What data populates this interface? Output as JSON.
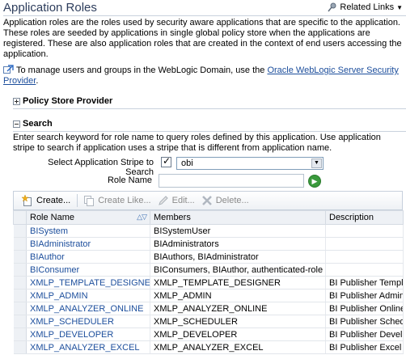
{
  "header": {
    "title": "Application Roles",
    "related_links": "Related Links"
  },
  "description": "Application roles are the roles used by security aware applications that are specific to the application. These roles are seeded by applications in single global policy store when the applications are registered. These are also application roles that are created in the context of end users accessing the application.",
  "info": {
    "text": "To manage users and groups in the WebLogic Domain, use the ",
    "link": "Oracle WebLogic Server Security Provider",
    "suffix": "."
  },
  "sections": {
    "policy_store": "Policy Store Provider",
    "search": "Search"
  },
  "search": {
    "description": "Enter search keyword for role name to query roles defined by this application. Use application stripe to search if application uses a stripe that is different from application name.",
    "stripe_label": "Select Application Stripe to Search",
    "stripe_checked": true,
    "stripe_value": "obi",
    "role_name_label": "Role Name",
    "role_name_value": ""
  },
  "toolbar": {
    "create": "Create...",
    "create_like": "Create Like...",
    "edit": "Edit...",
    "delete": "Delete..."
  },
  "table": {
    "columns": [
      "Role Name",
      "Members",
      "Description"
    ],
    "rows": [
      {
        "role": "BISystem",
        "members": "BISystemUser",
        "description": ""
      },
      {
        "role": "BIAdministrator",
        "members": "BIAdministrators",
        "description": ""
      },
      {
        "role": "BIAuthor",
        "members": "BIAuthors, BIAdministrator",
        "description": ""
      },
      {
        "role": "BIConsumer",
        "members": "BIConsumers, BIAuthor, authenticated-role",
        "description": ""
      },
      {
        "role": "XMLP_TEMPLATE_DESIGNER",
        "members": "XMLP_TEMPLATE_DESIGNER",
        "description": "BI Publisher Templ"
      },
      {
        "role": "XMLP_ADMIN",
        "members": "XMLP_ADMIN",
        "description": "BI Publisher Admin"
      },
      {
        "role": "XMLP_ANALYZER_ONLINE",
        "members": "XMLP_ANALYZER_ONLINE",
        "description": "BI Publisher Online"
      },
      {
        "role": "XMLP_SCHEDULER",
        "members": "XMLP_SCHEDULER",
        "description": "BI Publisher Sched"
      },
      {
        "role": "XMLP_DEVELOPER",
        "members": "XMLP_DEVELOPER",
        "description": "BI Publisher Devel"
      },
      {
        "role": "XMLP_ANALYZER_EXCEL",
        "members": "XMLP_ANALYZER_EXCEL",
        "description": "BI Publisher Excel"
      }
    ]
  },
  "colors": {
    "link": "#1c4e9c",
    "title": "#2d3d5c",
    "header_bg": "#eef1f5"
  }
}
